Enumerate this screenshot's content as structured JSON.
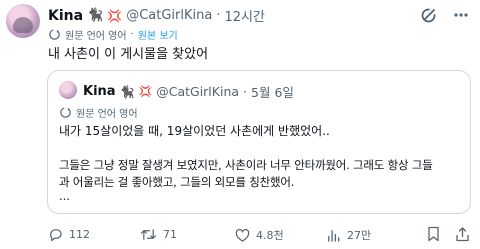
{
  "tweet": {
    "author_name": "Kina",
    "handle": "@CatGirlKina",
    "separator": "·",
    "time": "12시간",
    "translate_label": "원문 언어 영어",
    "translate_separator": "·",
    "show_original": "원본 보기",
    "text": "내 사촌이 이 게시물을 찾았어"
  },
  "quote": {
    "author_name": "Kina",
    "handle": "@CatGirlKina",
    "separator": "·",
    "date": "5월 6일",
    "translate_label": "원문 언어 영어",
    "line1": "내가 15살이었을 때, 19살이었던 사촌에게 반했었어..",
    "line2": "그들은 그냥 정말 잘생겨 보였지만, 사촌이라 너무 안타까웠어. 그래도 항상 그들",
    "line3": "과 어울리는 걸 좋아했고, 그들의 외모를 칭찬했어.",
    "line4": "..."
  },
  "actions": {
    "replies": "112",
    "retweets": "71",
    "likes": "4.8천",
    "views": "27만"
  },
  "colors": {
    "text": "#0f1419",
    "secondary": "#536471",
    "accent": "#1d9bf0",
    "border": "#cfd9de"
  },
  "icons": [
    "cat-emoji-icon",
    "anger-emoji-icon",
    "grok-icon",
    "more-icon",
    "translate-icon",
    "reply-icon",
    "retweet-icon",
    "like-icon",
    "views-icon",
    "bookmark-icon",
    "share-icon"
  ]
}
